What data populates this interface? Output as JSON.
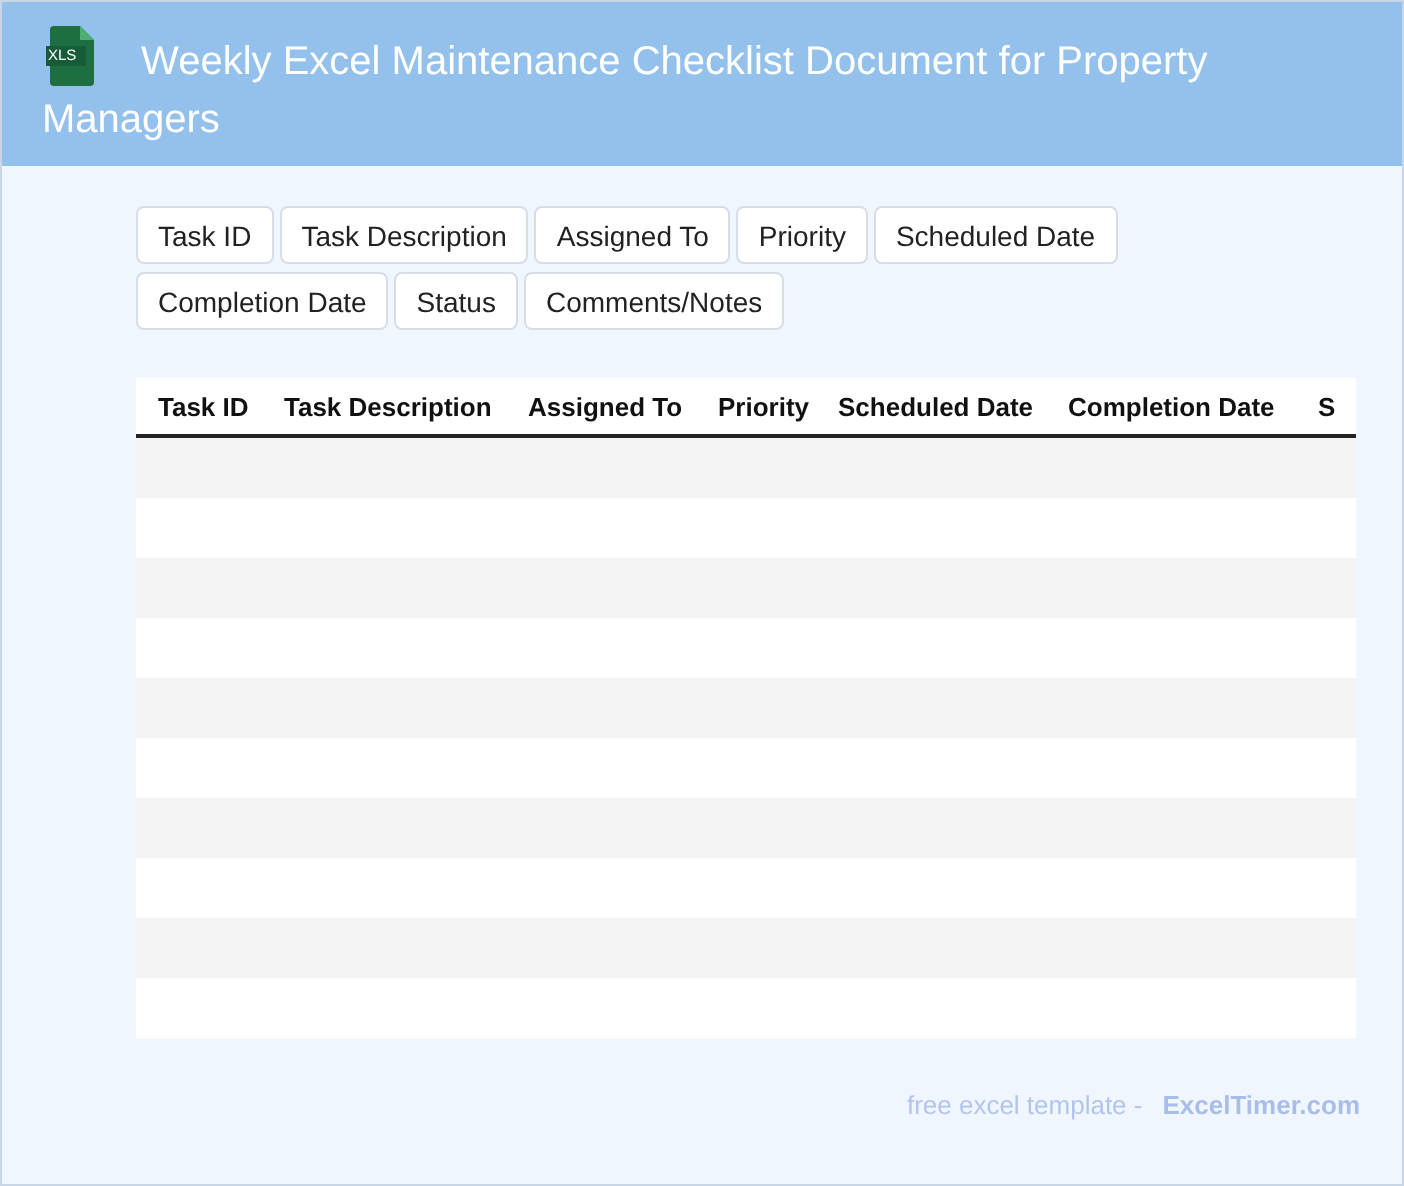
{
  "header": {
    "icon_label": "XLS",
    "title": "Weekly Excel Maintenance Checklist Document for Property Managers"
  },
  "column_chips": [
    "Task ID",
    "Task Description",
    "Assigned To",
    "Priority",
    "Scheduled Date",
    "Completion Date",
    "Status",
    "Comments/Notes"
  ],
  "table": {
    "columns": [
      "Task ID",
      "Task Description",
      "Assigned To",
      "Priority",
      "Scheduled Date",
      "Completion Date",
      "S"
    ]
  },
  "footer": {
    "text": "free excel template -",
    "link": "ExcelTimer.com"
  }
}
